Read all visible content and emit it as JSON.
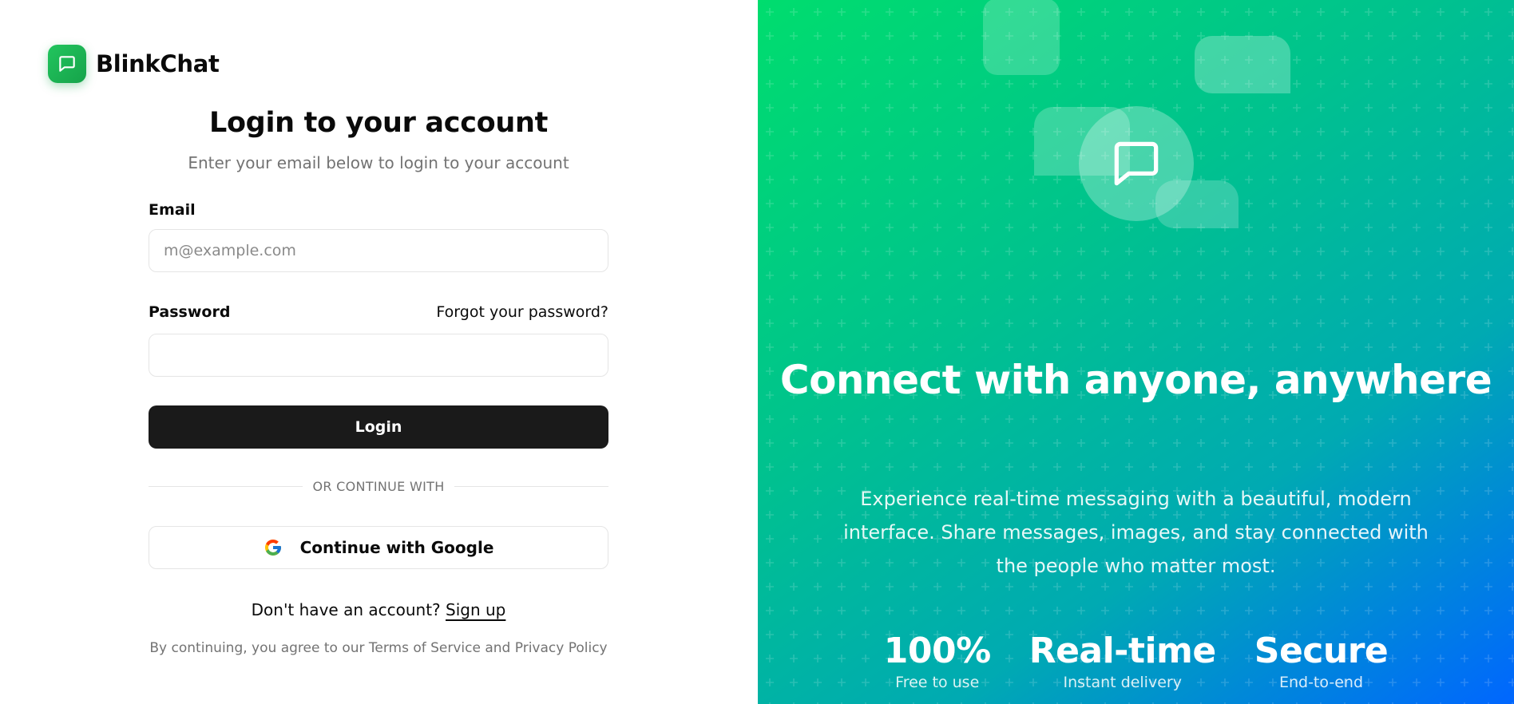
{
  "brand": {
    "name": "BlinkChat",
    "logo_icon": "chat-bubble-icon",
    "accent": "#22c55e"
  },
  "login": {
    "title": "Login to your account",
    "subtitle": "Enter your email below to login to your account",
    "email_label": "Email",
    "email_placeholder": "m@example.com",
    "email_value": "",
    "password_label": "Password",
    "password_value": "",
    "forgot_link": "Forgot your password?",
    "login_button": "Login",
    "divider_text": "OR CONTINUE WITH",
    "google_button": "Continue with Google",
    "google_icon": "google-icon",
    "signup_prompt": "Don't have an account?",
    "signup_link": "Sign up",
    "terms": "By continuing, you agree to our Terms of Service and Privacy Policy"
  },
  "hero": {
    "headline": "Connect with anyone, anywhere",
    "description": "Experience real-time messaging with a beautiful, modern interface. Share messages, images, and stay connected with the people who matter most.",
    "icon": "chat-bubble-icon",
    "gradient": [
      "#00dd6e",
      "#00c28e",
      "#00aab2",
      "#0066ff"
    ],
    "stats": [
      {
        "value": "100%",
        "label": "Free to use"
      },
      {
        "value": "Real-time",
        "label": "Instant delivery"
      },
      {
        "value": "Secure",
        "label": "End-to-end"
      }
    ]
  }
}
